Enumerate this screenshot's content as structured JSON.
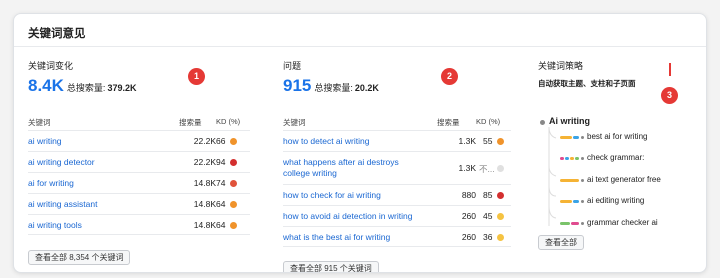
{
  "card": {
    "title": "关键词意见"
  },
  "variations": {
    "title": "关键词变化",
    "badge": "1",
    "count": "8.4K",
    "volume_label": "总搜索量:",
    "volume": "379.2K",
    "columns": [
      "关键词",
      "搜索量",
      "KD (%)"
    ],
    "rows": [
      {
        "keyword": "ai writing",
        "volume": "22.2K",
        "kd": "66",
        "kd_color": "#f0932b"
      },
      {
        "keyword": "ai writing detector",
        "volume": "22.2K",
        "kd": "94",
        "kd_color": "#d32f2f"
      },
      {
        "keyword": "ai for writing",
        "volume": "14.8K",
        "kd": "74",
        "kd_color": "#e0523a"
      },
      {
        "keyword": "ai writing assistant",
        "volume": "14.8K",
        "kd": "64",
        "kd_color": "#f0932b"
      },
      {
        "keyword": "ai writing tools",
        "volume": "14.8K",
        "kd": "64",
        "kd_color": "#f0932b"
      }
    ],
    "view_all": "查看全部 8,354 个关键词"
  },
  "questions": {
    "title": "问题",
    "badge": "2",
    "count": "915",
    "volume_label": "总搜索量:",
    "volume": "20.2K",
    "columns": [
      "关键词",
      "搜索量",
      "KD (%)"
    ],
    "rows": [
      {
        "keyword": "how to detect ai writing",
        "keyword_line2": "",
        "volume": "1.3K",
        "kd": "55",
        "kd_color": "#f0932b"
      },
      {
        "keyword": "what happens after ai destroys",
        "keyword_line2": "college writing",
        "volume": "1.3K",
        "kd": "不...",
        "kd_color": "#e0e0e0"
      },
      {
        "keyword": "how to check for ai writing",
        "keyword_line2": "",
        "volume": "880",
        "kd": "85",
        "kd_color": "#d32f2f"
      },
      {
        "keyword": "how to avoid ai detection in writing",
        "keyword_line2": "",
        "volume": "260",
        "kd": "45",
        "kd_color": "#f5c342"
      },
      {
        "keyword": "what is the best ai for writing",
        "keyword_line2": "",
        "volume": "260",
        "kd": "36",
        "kd_color": "#f5c342"
      }
    ],
    "view_all": "查看全部 915 个关键词"
  },
  "strategy": {
    "title": "关键词策略",
    "subtitle": "自动获取主题、支柱和子页面",
    "badge": "3",
    "root": "Ai writing",
    "leaves": [
      {
        "label": "best ai for writing",
        "colors": [
          "#f5b335",
          "#3aa3e6"
        ]
      },
      {
        "label": "check grammar:",
        "colors": [
          "#e04b8f",
          "#3aa3e6",
          "#f5b335",
          "#7ac36a"
        ]
      },
      {
        "label": "ai text generator free",
        "colors": [
          "#f5b335"
        ]
      },
      {
        "label": "ai editing writing",
        "colors": [
          "#f5b335",
          "#3aa3e6"
        ]
      },
      {
        "label": "grammar checker ai",
        "colors": [
          "#7ac36a",
          "#e04b8f"
        ]
      }
    ],
    "view_all": "查看全部"
  }
}
